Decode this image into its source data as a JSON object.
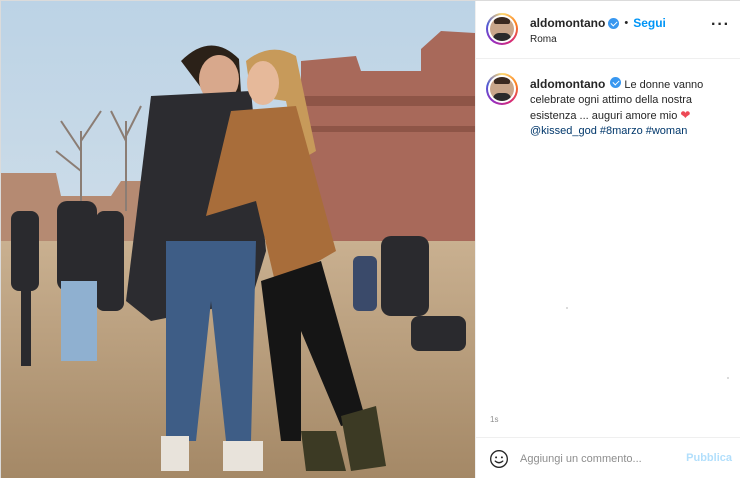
{
  "post": {
    "image_alt": "",
    "username": "aldomontano",
    "verified_icon": "verified-badge-icon",
    "separator": "•",
    "follow_label": "Segui",
    "location": "Roma",
    "more_icon": "more-options-icon",
    "more_label": "···"
  },
  "caption": {
    "username": "aldomontano",
    "text": "Le donne vanno celebrate ogni attimo della nostra esistenza ... auguri amore mio",
    "emoji": "❤",
    "mention": "@kissed_god",
    "hashtags": [
      "#8marzo",
      "#woman"
    ]
  },
  "timestamp": "1s",
  "comment": {
    "emoji_icon": "emoji-smile-icon",
    "placeholder": "Aggiungi un commento...",
    "publish_label": "Pubblica"
  },
  "colors": {
    "accent": "#0095f6",
    "publish_disabled": "#b2dffc",
    "heart": "#ed4956",
    "tag": "#00376b"
  }
}
